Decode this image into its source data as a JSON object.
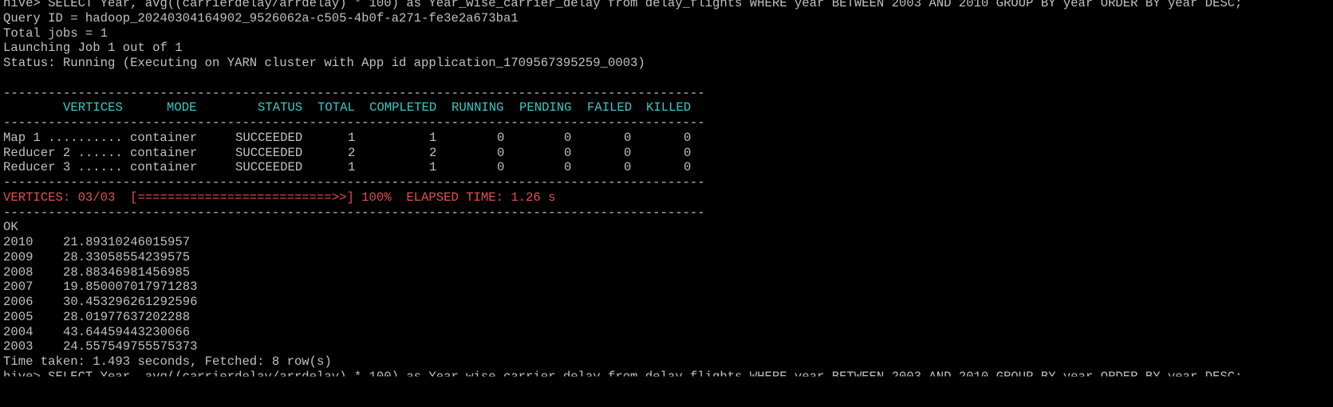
{
  "colors": {
    "background": "#000000",
    "text": "#c0c0c0",
    "header": "#3cc6c6",
    "progress": "#e05050"
  },
  "lines_top": [
    "hive> SELECT Year, avg((carrierdelay/arrdelay) * 100) as Year_wise_carrier_delay from delay_flights WHERE year BETWEEN 2003 AND 2010 GROUP BY year ORDER BY year DESC;",
    "Query ID = hadoop_20240304164902_9526062a-c505-4b0f-a271-fe3e2a673ba1",
    "Total jobs = 1",
    "Launching Job 1 out of 1",
    "Status: Running (Executing on YARN cluster with App id application_1709567395259_0003)"
  ],
  "rule": "----------------------------------------------------------------------------------------------------",
  "table": {
    "headers": [
      "VERTICES",
      "MODE",
      "STATUS",
      "TOTAL",
      "COMPLETED",
      "RUNNING",
      "PENDING",
      "FAILED",
      "KILLED"
    ],
    "rows": [
      [
        "Map 1 ..........",
        "container",
        "SUCCEEDED",
        "1",
        "1",
        "0",
        "0",
        "0",
        "0"
      ],
      [
        "Reducer 2 ......",
        "container",
        "SUCCEEDED",
        "2",
        "2",
        "0",
        "0",
        "0",
        "0"
      ],
      [
        "Reducer 3 ......",
        "container",
        "SUCCEEDED",
        "1",
        "1",
        "0",
        "0",
        "0",
        "0"
      ]
    ]
  },
  "progress_line": "VERTICES: 03/03  [==========================>>] 100%  ELAPSED TIME: 1.26 s",
  "ok": "OK",
  "results": [
    {
      "year": "2010",
      "value": "21.89310246015957"
    },
    {
      "year": "2009",
      "value": "28.33058554239575"
    },
    {
      "year": "2008",
      "value": "28.88346981456985"
    },
    {
      "year": "2007",
      "value": "19.850007017971283"
    },
    {
      "year": "2006",
      "value": "30.453296261292596"
    },
    {
      "year": "2005",
      "value": "28.01977637202288"
    },
    {
      "year": "2004",
      "value": "43.64459443230066"
    },
    {
      "year": "2003",
      "value": "24.557549755575373"
    }
  ],
  "time_taken": "Time taken: 1.493 seconds, Fetched: 8 row(s)",
  "next_prompt": "hive> SELECT Year, avg((carrierdelay/arrdelay) * 100) as Year_wise_carrier_delay from delay_flights WHERE year BETWEEN 2003 AND 2010 GROUP BY year ORDER BY year DESC;"
}
